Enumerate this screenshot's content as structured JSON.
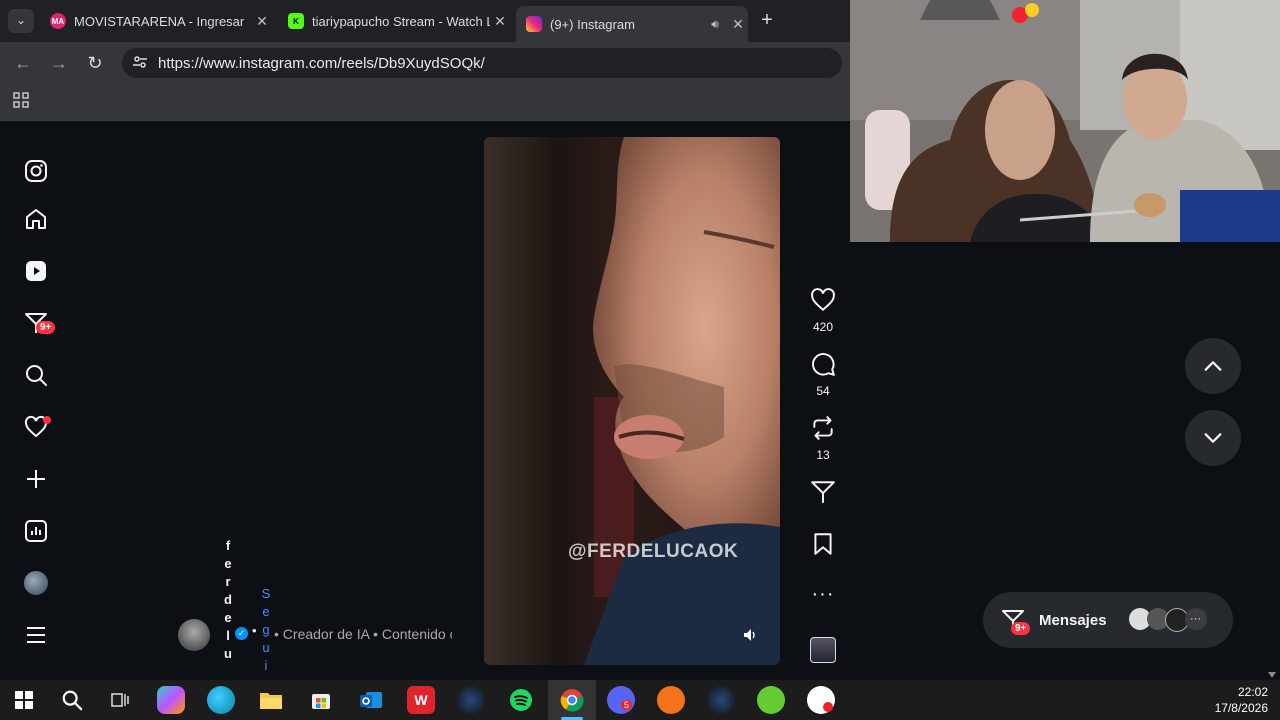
{
  "browser": {
    "tabs": [
      {
        "label": "MOVISTARARENA - Ingresar",
        "favicon_text": "MA"
      },
      {
        "label": "tiariypapucho Stream - Watch Li",
        "favicon_text": "K"
      },
      {
        "label": "(9+) Instagram",
        "favicon_text": ""
      }
    ],
    "url": "https://www.instagram.com/reels/Db9XuydSOQk/"
  },
  "sidebar": {
    "notifications_badge": "9+"
  },
  "reel": {
    "watermark": "@FERDELUCAOK",
    "likes": "420",
    "comments": "54",
    "reposts": "13",
    "username_letters": [
      "f",
      "e",
      "r",
      "d",
      "e",
      "l",
      "u"
    ],
    "follow_letters": [
      "S",
      "e",
      "g",
      "u",
      "i"
    ],
    "meta": "• Creador de IA • Contenido c"
  },
  "messages": {
    "label": "Mensajes",
    "badge": "9+",
    "more": "···"
  },
  "taskbar": {
    "time": "22:02",
    "date": "17/8/2026",
    "discord_badge": "5"
  },
  "colors": {
    "instagram_bg": "#0c1014",
    "badge_red": "#ff3040",
    "verified_blue": "#0095f6",
    "follow_blue": "#4a8cff"
  }
}
